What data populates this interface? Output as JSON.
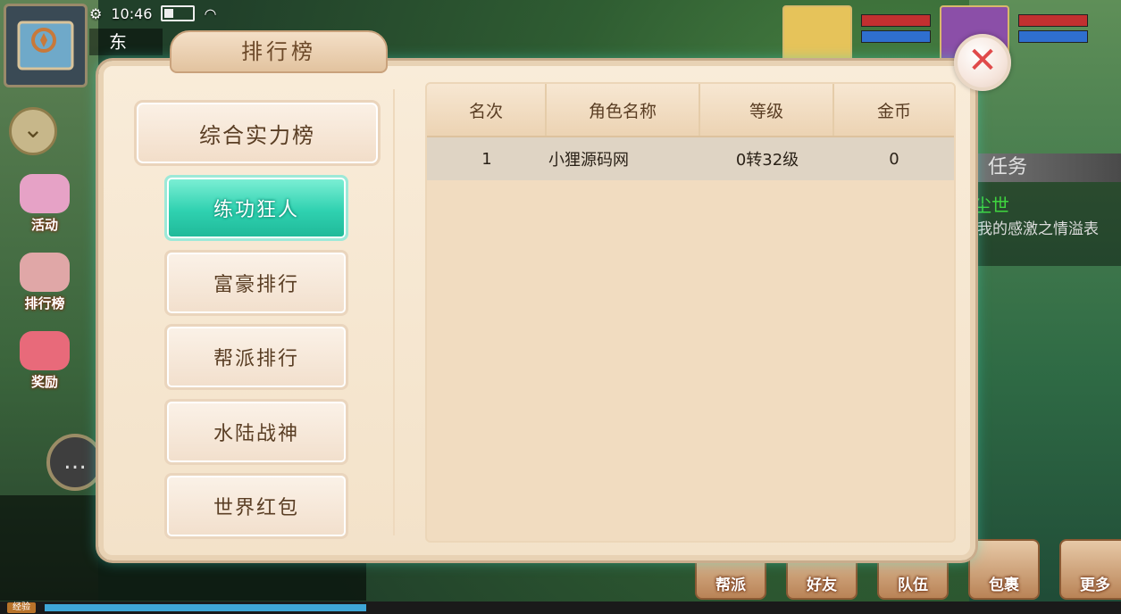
{
  "status": {
    "time": "10:46"
  },
  "location": {
    "name": "东"
  },
  "side_menu": [
    {
      "label": "活动"
    },
    {
      "label": "排行榜"
    },
    {
      "label": "奖励"
    }
  ],
  "task": {
    "title": "任务",
    "line": "入尘世",
    "text": "路过我的感激之情溢表啊"
  },
  "bottom_menu": [
    {
      "label": "帮派"
    },
    {
      "label": "好友"
    },
    {
      "label": "队伍"
    },
    {
      "label": "包裹"
    },
    {
      "label": "更多"
    }
  ],
  "exp": {
    "label": "经验"
  },
  "dialog": {
    "title": "排行榜",
    "close_symbol": "✕",
    "main_tab": "综合实力榜",
    "sub_tabs": [
      "练功狂人",
      "富豪排行",
      "帮派排行",
      "水陆战神",
      "世界红包"
    ],
    "active_tab": "练功狂人",
    "table": {
      "headers": [
        "名次",
        "角色名称",
        "等级",
        "金币"
      ],
      "rows": [
        {
          "rank": "1",
          "name": "小狸源码网",
          "level": "0转32级",
          "gold": "0"
        }
      ]
    }
  },
  "colors": {
    "active_tab": "#2fd1b0",
    "panel": "#f3e2c9",
    "close_x": "#e04a4a"
  }
}
